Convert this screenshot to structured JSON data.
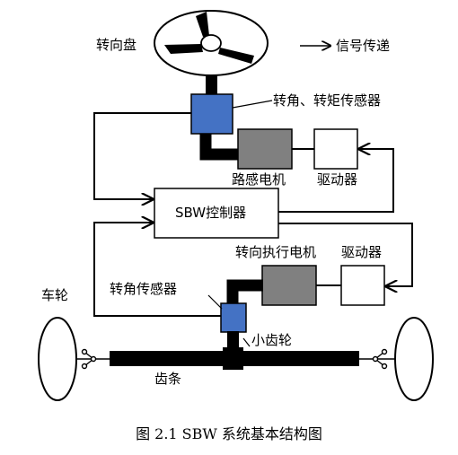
{
  "labels": {
    "steering_wheel": "转向盘",
    "signal_legend": "信号传递",
    "angle_torque_sensor": "转角、转矩传感器",
    "road_feel_motor": "路感电机",
    "driver_top": "驱动器",
    "controller": "SBW控制器",
    "steer_motor": "转向执行电机",
    "driver_bottom": "驱动器",
    "angle_sensor": "转角传感器",
    "wheel": "车轮",
    "pinion": "小齿轮",
    "rack": "齿条"
  },
  "caption": "图 2.1    SBW 系统基本结构图",
  "colors": {
    "sensor": "#4472c4",
    "motor": "#808080",
    "line": "#000000",
    "background": "#ffffff"
  }
}
